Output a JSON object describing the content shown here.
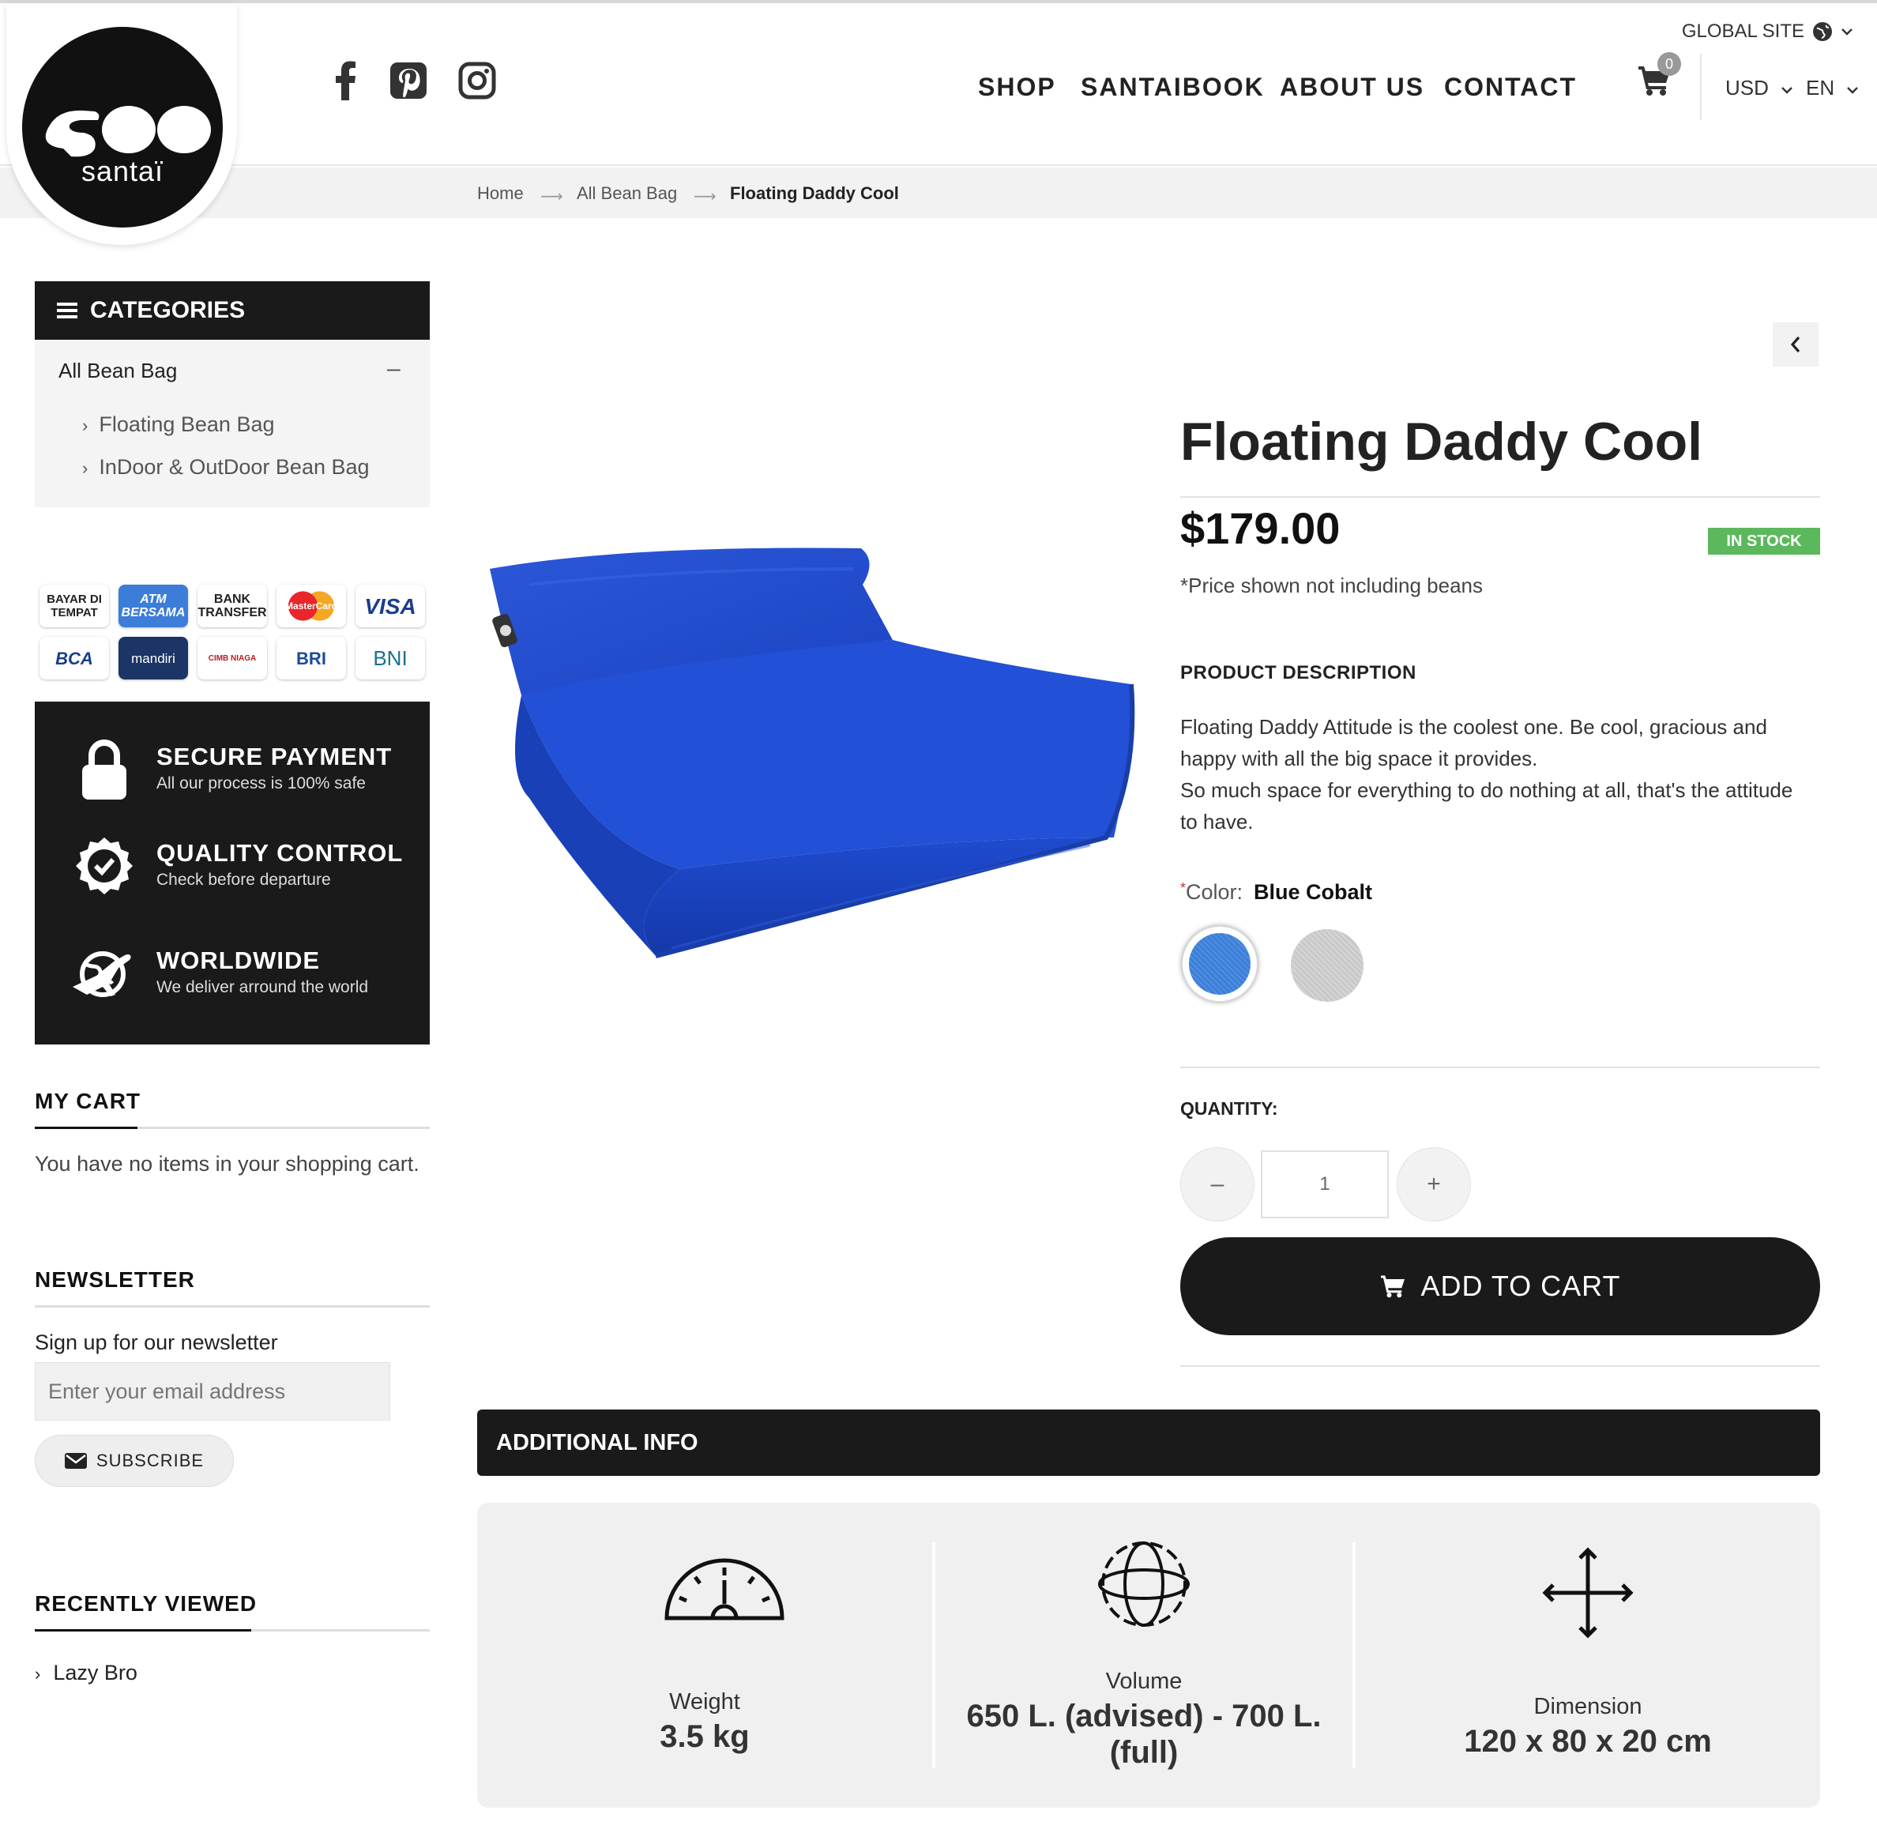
{
  "header": {
    "logo_text": "santaï",
    "social": [
      "facebook-icon",
      "pinterest-icon",
      "instagram-icon"
    ],
    "nav": [
      "SHOP",
      "SANTAIBOOK",
      "ABOUT US",
      "CONTACT"
    ],
    "global_site": "GLOBAL SITE",
    "cart_count": "0",
    "currency": "USD",
    "language": "EN"
  },
  "breadcrumb": [
    "Home",
    "All Bean Bag",
    "Floating Daddy Cool"
  ],
  "sidebar": {
    "categories_title": "CATEGORIES",
    "main_category": "All Bean Bag",
    "collapse_symbol": "–",
    "subcategories": [
      "Floating Bean Bag",
      "InDoor & OutDoor Bean Bag"
    ],
    "payment_methods": [
      "BAYAR DI TEMPAT",
      "ATM BERSAMA",
      "BANK TRANSFER",
      "MasterCard",
      "VISA",
      "BCA",
      "mandiri",
      "CIMB NIAGA",
      "BRI",
      "BNI"
    ],
    "trust": [
      {
        "title": "SECURE PAYMENT",
        "subtitle": "All our process is 100% safe",
        "icon": "lock-icon"
      },
      {
        "title": "QUALITY CONTROL",
        "subtitle": "Check before departure",
        "icon": "badge-check-icon"
      },
      {
        "title": "WORLDWIDE",
        "subtitle": "We deliver arround the world",
        "icon": "globe-plane-icon"
      }
    ],
    "my_cart_title": "MY CART",
    "my_cart_text": "You have no items in your shopping cart.",
    "newsletter_title": "NEWSLETTER",
    "newsletter_text": "Sign up for our newsletter",
    "email_placeholder": "Enter your email address",
    "subscribe_label": "SUBSCRIBE",
    "recently_title": "RECENTLY VIEWED",
    "recently_items": [
      "Lazy Bro"
    ]
  },
  "product": {
    "title": "Floating Daddy Cool",
    "price": "$179.00",
    "stock": "IN STOCK",
    "price_note": "*Price shown not including beans",
    "description_title": "PRODUCT DESCRIPTION",
    "description": "Floating Daddy Attitude is the coolest one. Be cool, gracious and happy with all the big space it provides.\nSo much space for everything to do nothing at all, that's the attitude to have.",
    "color_required_mark": "*",
    "color_label": "Color:",
    "color_value": "Blue Cobalt",
    "colors": [
      "#3a7fd8",
      "#c8c8c8"
    ],
    "quantity_label": "QUANTITY:",
    "quantity_value": "1",
    "minus": "–",
    "plus": "+",
    "add_to_cart": "ADD TO CART"
  },
  "additional_info": {
    "title": "ADDITIONAL INFO",
    "items": [
      {
        "label": "Weight",
        "value": "3.5 kg",
        "icon": "gauge-icon"
      },
      {
        "label": "Volume",
        "value": "650 L. (advised) - 700 L. (full)",
        "icon": "volume-sphere-icon"
      },
      {
        "label": "Dimension",
        "value": "120 x 80 x 20 cm",
        "icon": "arrows-cross-icon"
      }
    ]
  }
}
